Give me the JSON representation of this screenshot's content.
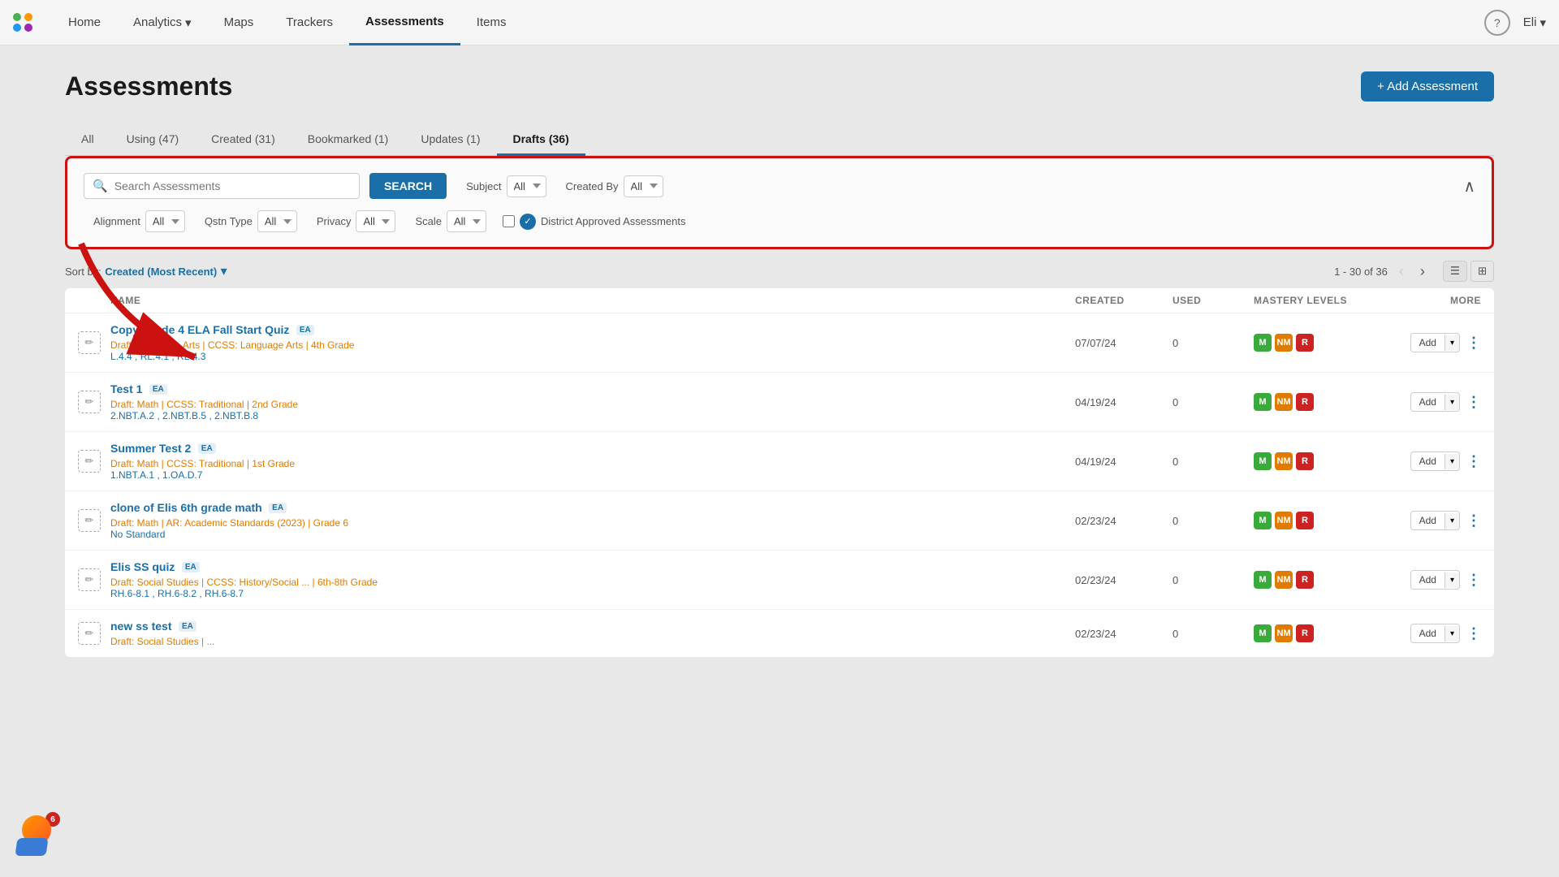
{
  "nav": {
    "logo_alt": "App Logo",
    "links": [
      {
        "id": "home",
        "label": "Home",
        "active": false
      },
      {
        "id": "analytics",
        "label": "Analytics",
        "active": false,
        "has_dropdown": true
      },
      {
        "id": "maps",
        "label": "Maps",
        "active": false
      },
      {
        "id": "trackers",
        "label": "Trackers",
        "active": false
      },
      {
        "id": "assessments",
        "label": "Assessments",
        "active": true
      },
      {
        "id": "items",
        "label": "Items",
        "active": false
      }
    ],
    "help_label": "?",
    "user_label": "Eli"
  },
  "page": {
    "title": "Assessments",
    "add_button": "+ Add Assessment"
  },
  "tabs": [
    {
      "id": "all",
      "label": "All",
      "active": false
    },
    {
      "id": "using",
      "label": "Using (47)",
      "active": false
    },
    {
      "id": "created",
      "label": "Created (31)",
      "active": false
    },
    {
      "id": "bookmarked",
      "label": "Bookmarked (1)",
      "active": false
    },
    {
      "id": "updates",
      "label": "Updates (1)",
      "active": false
    },
    {
      "id": "drafts",
      "label": "Drafts (36)",
      "active": true
    }
  ],
  "search": {
    "placeholder": "Search Assessments",
    "button_label": "SEARCH",
    "subject_label": "Subject",
    "subject_value": "All",
    "created_by_label": "Created By",
    "created_by_value": "All",
    "alignment_label": "Alignment",
    "alignment_value": "All",
    "qstn_type_label": "Qstn Type",
    "qstn_type_value": "All",
    "privacy_label": "Privacy",
    "privacy_value": "All",
    "scale_label": "Scale",
    "scale_value": "All",
    "district_label": "District Approved Assessments"
  },
  "list_controls": {
    "sort_prefix": "Sort by:",
    "sort_value": "Created (Most Recent)",
    "pagination": "1 - 30 of 36"
  },
  "table": {
    "columns": [
      "",
      "NAME",
      "CREATED",
      "USED",
      "MASTERY LEVELS",
      "MORE"
    ],
    "rows": [
      {
        "name": "Copy Grade 4 ELA Fall Start Quiz",
        "has_ea": true,
        "draft_meta": "Draft: Language Arts  |  CCSS: Language Arts  |  4th Grade",
        "standards": "L.4.4 , RL.4.1 , RL.4.3",
        "created": "07/07/24",
        "used": "0",
        "add_label": "Add"
      },
      {
        "name": "Test 1",
        "has_ea": true,
        "draft_meta": "Draft: Math  |  CCSS: Traditional  |  2nd Grade",
        "standards": "2.NBT.A.2 , 2.NBT.B.5 , 2.NBT.B.8",
        "created": "04/19/24",
        "used": "0",
        "add_label": "Add"
      },
      {
        "name": "Summer Test 2",
        "has_ea": true,
        "draft_meta": "Draft: Math  |  CCSS: Traditional  |  1st Grade",
        "standards": "1.NBT.A.1 , 1.OA.D.7",
        "created": "04/19/24",
        "used": "0",
        "add_label": "Add"
      },
      {
        "name": "clone of Elis 6th grade math",
        "has_ea": true,
        "draft_meta": "Draft: Math  |  AR: Academic Standards (2023)  |  Grade 6",
        "standards": "No Standard",
        "created": "02/23/24",
        "used": "0",
        "add_label": "Add"
      },
      {
        "name": "Elis SS quiz",
        "has_ea": true,
        "draft_meta": "Draft: Social Studies  |  CCSS: History/Social ...  |  6th-8th Grade",
        "standards": "RH.6-8.1 , RH.6-8.2 , RH.6-8.7",
        "created": "02/23/24",
        "used": "0",
        "add_label": "Add"
      },
      {
        "name": "new ss test",
        "has_ea": true,
        "draft_meta": "Draft: Social Studies  |  ...",
        "standards": "",
        "created": "02/23/24",
        "used": "0",
        "add_label": "Add"
      }
    ]
  },
  "notif_count": "6"
}
